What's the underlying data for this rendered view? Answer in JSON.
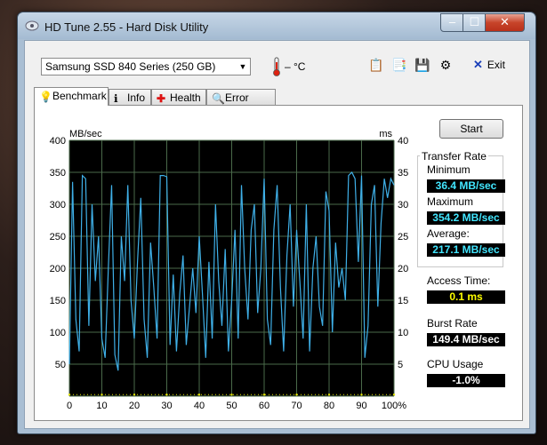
{
  "window": {
    "title": "HD Tune 2.55 - Hard Disk Utility"
  },
  "toolbar": {
    "drive": "Samsung SSD 840 Series (250 GB)",
    "temperature": "– °C",
    "exit_label": "Exit"
  },
  "tabs": [
    {
      "label": "Benchmark",
      "icon": "lightbulb-icon"
    },
    {
      "label": "Info",
      "icon": "info-icon"
    },
    {
      "label": "Health",
      "icon": "health-cross-icon"
    },
    {
      "label": "Error Scan",
      "icon": "magnifier-icon"
    }
  ],
  "benchmark": {
    "start_label": "Start",
    "transfer_rate_title": "Transfer Rate",
    "minimum_label": "Minimum",
    "minimum_value": "36.4 MB/sec",
    "maximum_label": "Maximum",
    "maximum_value": "354.2 MB/sec",
    "average_label": "Average:",
    "average_value": "217.1 MB/sec",
    "access_time_label": "Access Time:",
    "access_time_value": "0.1 ms",
    "burst_rate_label": "Burst Rate",
    "burst_rate_value": "149.4 MB/sec",
    "cpu_usage_label": "CPU Usage",
    "cpu_usage_value": "-1.0%"
  },
  "chart_data": {
    "type": "line",
    "ylabel": "MB/sec",
    "y2label": "ms",
    "ylim": [
      0,
      400
    ],
    "y2lim": [
      0,
      40
    ],
    "xlim": [
      0,
      100
    ],
    "xticks": [
      "0",
      "10",
      "20",
      "30",
      "40",
      "50",
      "60",
      "70",
      "80",
      "90",
      "100%"
    ],
    "yticks": [
      "400",
      "350",
      "300",
      "250",
      "200",
      "150",
      "100",
      "50"
    ],
    "y2ticks": [
      "40",
      "35",
      "30",
      "25",
      "20",
      "15",
      "10",
      "5"
    ],
    "grid": true,
    "colors": {
      "background": "#000000",
      "grid": "#4a6a4a",
      "transfer": "#3fb0e8",
      "access": "#e8e800"
    },
    "series": [
      {
        "kind": "transfer",
        "x": [
          0,
          1,
          2,
          3,
          4,
          5,
          6,
          7,
          8,
          9,
          10,
          11,
          12,
          13,
          14,
          15,
          16,
          17,
          18,
          19,
          20,
          21,
          22,
          23,
          24,
          25,
          26,
          27,
          28,
          29,
          30,
          31,
          32,
          33,
          34,
          35,
          36,
          37,
          38,
          39,
          40,
          41,
          42,
          43,
          44,
          45,
          46,
          47,
          48,
          49,
          50,
          51,
          52,
          53,
          54,
          55,
          56,
          57,
          58,
          59,
          60,
          61,
          62,
          63,
          64,
          65,
          66,
          67,
          68,
          69,
          70,
          71,
          72,
          73,
          74,
          75,
          76,
          77,
          78,
          79,
          80,
          81,
          82,
          83,
          84,
          85,
          86,
          87,
          88,
          89,
          90,
          91,
          92,
          93,
          94,
          95,
          96,
          97,
          98,
          99,
          100
        ],
        "y": [
          50,
          335,
          120,
          70,
          345,
          340,
          110,
          300,
          180,
          250,
          90,
          60,
          200,
          330,
          65,
          40,
          250,
          180,
          330,
          150,
          90,
          210,
          310,
          120,
          60,
          240,
          170,
          90,
          345,
          345,
          343,
          80,
          190,
          70,
          160,
          220,
          80,
          140,
          200,
          130,
          250,
          160,
          60,
          210,
          90,
          300,
          180,
          110,
          230,
          70,
          150,
          260,
          90,
          330,
          200,
          120,
          260,
          300,
          130,
          200,
          340,
          120,
          80,
          260,
          330,
          170,
          70,
          220,
          300,
          140,
          260,
          180,
          90,
          300,
          70,
          200,
          250,
          140,
          110,
          320,
          290,
          100,
          240,
          170,
          200,
          150,
          345,
          350,
          340,
          210,
          345,
          60,
          110,
          300,
          330,
          140,
          270,
          340,
          310,
          340,
          330
        ]
      },
      {
        "kind": "access",
        "x": [
          0,
          10,
          20,
          30,
          40,
          50,
          60,
          70,
          80,
          90,
          100
        ],
        "y2": [
          0.1,
          0.1,
          0.1,
          0.1,
          0.1,
          0.1,
          0.1,
          0.1,
          0.1,
          0.1,
          0.1
        ]
      }
    ]
  }
}
